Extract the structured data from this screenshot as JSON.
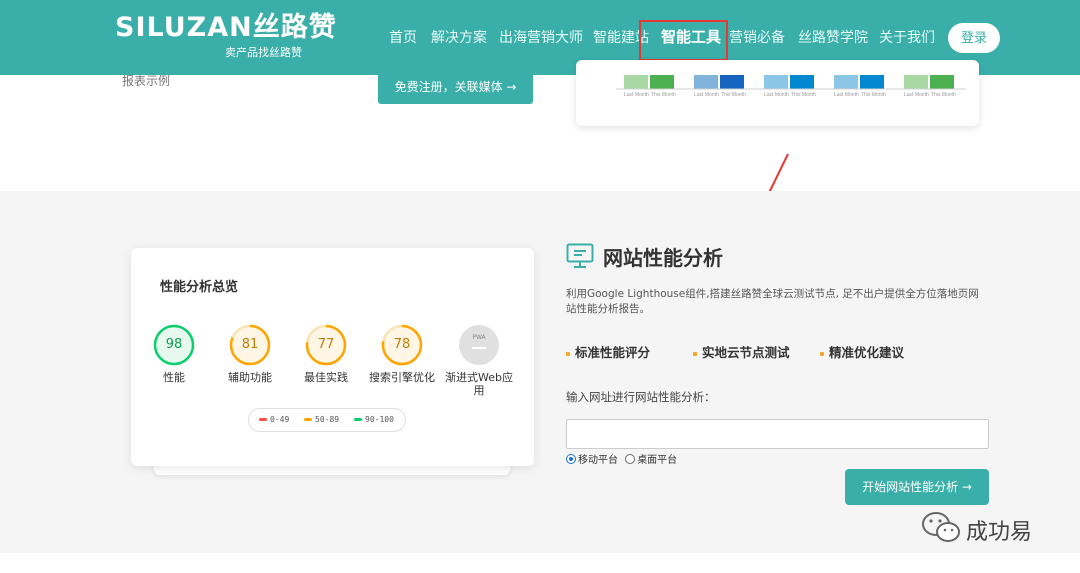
{
  "header": {
    "logo_main": "SILUZAN丝路赞",
    "logo_sub": "卖产品找丝路赞",
    "nav": [
      {
        "label": "首页"
      },
      {
        "label": "解决方案"
      },
      {
        "label": "出海营销大师"
      },
      {
        "label": "智能建站"
      },
      {
        "label": "智能工具",
        "active": true
      },
      {
        "label": "营销必备"
      },
      {
        "label": "丝路赞学院"
      },
      {
        "label": "关于我们"
      }
    ],
    "login_label": "登录"
  },
  "top_section": {
    "report_sample": "报表示例",
    "register_button": "免费注册，关联媒体 →",
    "chart_labels": [
      "Last Month",
      "This Month"
    ]
  },
  "perf_card": {
    "title": "性能分析总览",
    "scores": [
      {
        "value": "98",
        "label": "性能",
        "color": "#0cce6b"
      },
      {
        "value": "81",
        "label": "辅助功能",
        "color": "#ffa400"
      },
      {
        "value": "77",
        "label": "最佳实践",
        "color": "#ffa400"
      },
      {
        "value": "78",
        "label": "搜索引擎优化",
        "color": "#ffa400"
      },
      {
        "value": "PWA",
        "label": "渐进式Web应用",
        "color": "#cccccc"
      }
    ],
    "legend": [
      {
        "range": "0-49",
        "color": "#ff4e42"
      },
      {
        "range": "50-89",
        "color": "#ffa400"
      },
      {
        "range": "90-100",
        "color": "#0cce6b"
      }
    ]
  },
  "analysis": {
    "title": "网站性能分析",
    "description": "利用Google Lighthouse组件,搭建丝路赞全球云测试节点, 足不出户提供全方位落地页网站性能分析报告。",
    "features": [
      "标准性能评分",
      "实地云节点测试",
      "精准优化建议"
    ],
    "url_label": "输入网址进行网站性能分析：",
    "url_value": "",
    "platforms": [
      {
        "label": "移动平台",
        "checked": true
      },
      {
        "label": "桌面平台",
        "checked": false
      }
    ],
    "start_button": "开始网站性能分析 →"
  },
  "watermark": {
    "text": "成功易"
  },
  "colors": {
    "brand": "#3aafa9",
    "highlight": "#e53935",
    "feature_dot": "#f5a623"
  }
}
